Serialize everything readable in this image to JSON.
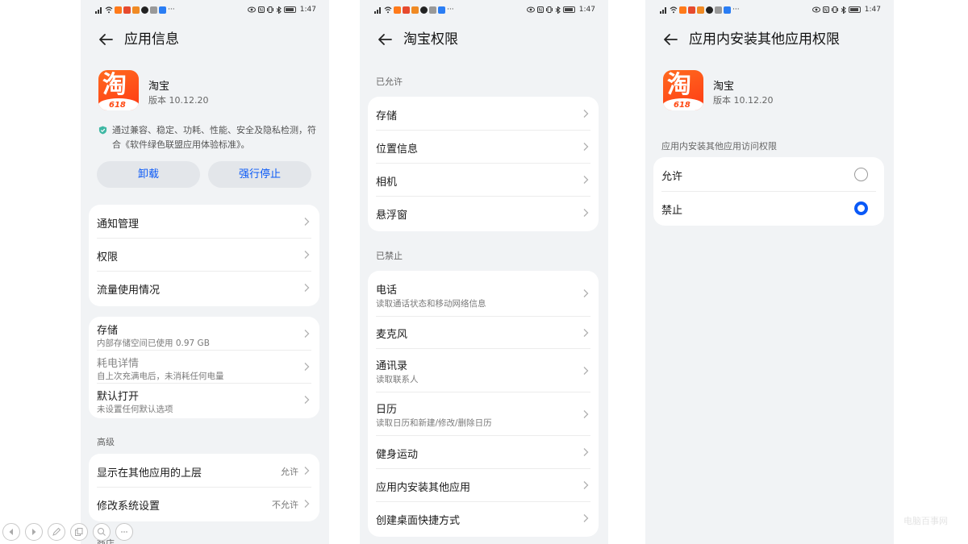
{
  "status": {
    "time": "1:47"
  },
  "screen1": {
    "title": "应用信息",
    "app_name": "淘宝",
    "app_version": "版本 10.12.20",
    "notice": "通过兼容、稳定、功耗、性能、安全及隐私检测，符合《软件绿色联盟应用体验标准》。",
    "uninstall_label": "卸载",
    "force_stop_label": "强行停止",
    "card1": [
      "通知管理",
      "权限",
      "流量使用情况"
    ],
    "storage": {
      "label": "存储",
      "sub": "内部存储空间已使用 0.97 GB"
    },
    "battery": {
      "label": "耗电详情",
      "sub": "自上次充满电后，未消耗任何电量"
    },
    "default_open": {
      "label": "默认打开",
      "sub": "未设置任何默认选项"
    },
    "advanced_label": "高级",
    "overlay": {
      "label": "显示在其他应用的上层",
      "value": "允许"
    },
    "system_settings": {
      "label": "修改系统设置",
      "value": "不允许"
    },
    "cutoff_label": "商店"
  },
  "screen2": {
    "title": "淘宝权限",
    "allowed_label": "已允许",
    "allowed": [
      "存储",
      "位置信息",
      "相机",
      "悬浮窗"
    ],
    "denied_label": "已禁止",
    "denied": [
      {
        "label": "电话",
        "sub": "读取通话状态和移动网络信息"
      },
      {
        "label": "麦克风",
        "sub": ""
      },
      {
        "label": "通讯录",
        "sub": "读取联系人"
      },
      {
        "label": "日历",
        "sub": "读取日历和新建/修改/删除日历"
      },
      {
        "label": "健身运动",
        "sub": ""
      },
      {
        "label": "应用内安装其他应用",
        "sub": ""
      },
      {
        "label": "创建桌面快捷方式",
        "sub": ""
      }
    ]
  },
  "screen3": {
    "title": "应用内安装其他应用权限",
    "app_name": "淘宝",
    "app_version": "版本 10.12.20",
    "section_label": "应用内安装其他应用访问权限",
    "options": [
      {
        "label": "允许",
        "selected": false
      },
      {
        "label": "禁止",
        "selected": true
      }
    ]
  },
  "logo": {
    "glyph": "淘",
    "tag": "618"
  },
  "watermark": "电脑百事网",
  "icons": {
    "back": "back-arrow-icon",
    "chevron": "chevron-right-icon",
    "shield": "shield-check-icon",
    "toolbar": [
      "prev-icon",
      "next-icon",
      "pen-icon",
      "copy-icon",
      "zoom-icon",
      "more-icon"
    ]
  },
  "colors": {
    "accent": "#0a59f7",
    "background": "#f1f3f5",
    "card": "#ffffff",
    "logo": "#ff4a14"
  }
}
